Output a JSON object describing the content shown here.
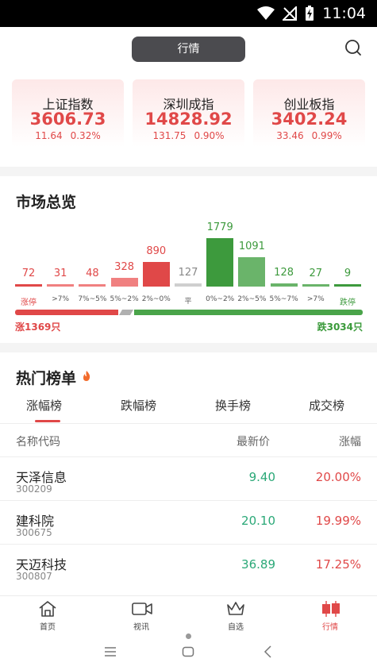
{
  "status_bar": {
    "time": "11:04"
  },
  "header": {
    "active_tab": "行情"
  },
  "indices": [
    {
      "name": "上证指数",
      "value": "3606.73",
      "change": "11.64",
      "pct": "0.32%"
    },
    {
      "name": "深圳成指",
      "value": "14828.92",
      "change": "131.75",
      "pct": "0.90%"
    },
    {
      "name": "创业板指",
      "value": "3402.24",
      "change": "33.46",
      "pct": "0.99%"
    }
  ],
  "market": {
    "title": "市场总览",
    "up_text": "涨1369只",
    "down_text": "跌3034只",
    "colors": {
      "up": "#e04848",
      "up_light": "#f08080",
      "flat": "#cfcfcf",
      "down": "#3d9a3d",
      "down_light": "#6ab46a"
    }
  },
  "chart_data": {
    "type": "bar",
    "categories": [
      "涨停",
      ">7%",
      "7%~5%",
      "5%~2%",
      "2%~0%",
      "平",
      "0%~2%",
      "2%~5%",
      "5%~7%",
      ">7%",
      "跌停"
    ],
    "values": [
      72,
      31,
      48,
      328,
      890,
      127,
      1779,
      1091,
      128,
      27,
      9
    ]
  },
  "hot": {
    "title": "热门榜单",
    "tabs": [
      "涨幅榜",
      "跌幅榜",
      "换手榜",
      "成交榜"
    ],
    "columns": {
      "name": "名称代码",
      "price": "最新价",
      "pct": "涨幅"
    },
    "rows": [
      {
        "name": "天泽信息",
        "code": "300209",
        "price": "9.40",
        "pct": "20.00%"
      },
      {
        "name": "建科院",
        "code": "300675",
        "price": "20.10",
        "pct": "19.99%"
      },
      {
        "name": "天迈科技",
        "code": "300807",
        "price": "36.89",
        "pct": "17.25%"
      }
    ]
  },
  "tabbar": {
    "items": [
      {
        "label": "首页",
        "icon": "home-icon"
      },
      {
        "label": "视讯",
        "icon": "video-icon"
      },
      {
        "label": "自选",
        "icon": "crown-icon"
      },
      {
        "label": "行情",
        "icon": "candlestick-icon"
      }
    ]
  }
}
